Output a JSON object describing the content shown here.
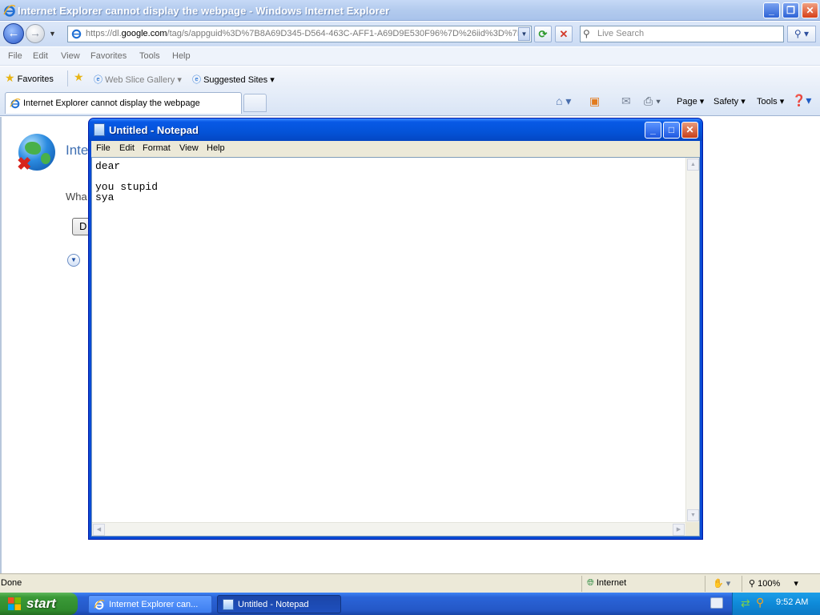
{
  "ie": {
    "title": "Internet Explorer cannot display the webpage - Windows Internet Explorer",
    "address_url_prefix": "https://dl.",
    "address_url_domain": "google.com",
    "address_url_rest": "/tag/s/appguid%3D%7B8A69D345-D564-463C-AFF1-A69D9E530F96%7D%26iid%3D%7I",
    "search_placeholder": "Live Search",
    "menu": [
      "File",
      "Edit",
      "View",
      "Favorites",
      "Tools",
      "Help"
    ],
    "favorites_label": "Favorites",
    "web_slice_gallery": "Web Slice Gallery",
    "suggested_sites": "Suggested Sites",
    "tab_title": "Internet Explorer cannot display the webpage",
    "cmd_page": "Page",
    "cmd_safety": "Safety",
    "cmd_tools": "Tools",
    "content_heading": "Inte",
    "content_what": "Wha",
    "content_button": "D",
    "status_text": "Done",
    "status_zone": "Internet",
    "status_zoom": "100%"
  },
  "notepad": {
    "title": "Untitled - Notepad",
    "menu": [
      "File",
      "Edit",
      "Format",
      "View",
      "Help"
    ],
    "content": "dear\n\nyou stupid\nsya"
  },
  "taskbar": {
    "start_label": "start",
    "tasks": [
      "Internet Explorer can...",
      "Untitled - Notepad"
    ],
    "clock": "9:52 AM"
  }
}
